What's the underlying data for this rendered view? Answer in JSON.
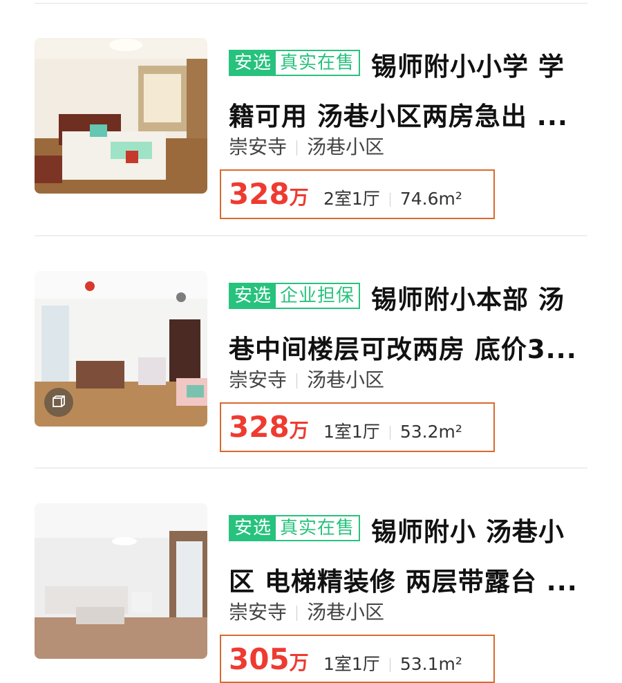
{
  "listings": [
    {
      "tag_primary": "安选",
      "tag_secondary": "真实在售",
      "title": "锡师附小小学 学籍可用 汤巷小区两房急出 ...",
      "area": "崇安寺",
      "community": "汤巷小区",
      "price": "328",
      "price_unit": "万",
      "layout": "2室1厅",
      "size": "74.6m²"
    },
    {
      "tag_primary": "安选",
      "tag_secondary": "企业担保",
      "title": "锡师附小本部 汤巷中间楼层可改两房 底价3...",
      "area": "崇安寺",
      "community": "汤巷小区",
      "price": "328",
      "price_unit": "万",
      "layout": "1室1厅",
      "size": "53.2m²",
      "has_vr": true
    },
    {
      "tag_primary": "安选",
      "tag_secondary": "真实在售",
      "title": "锡师附小 汤巷小区 电梯精装修 两层带露台 ...",
      "area": "崇安寺",
      "community": "汤巷小区",
      "price": "305",
      "price_unit": "万",
      "layout": "1室1厅",
      "size": "53.1m²"
    }
  ],
  "colors": {
    "tag_green": "#27c27d",
    "price_red": "#ee3b31",
    "highlight_box": "#d9692e"
  },
  "icons": {
    "vr": "vr-cube-icon"
  }
}
